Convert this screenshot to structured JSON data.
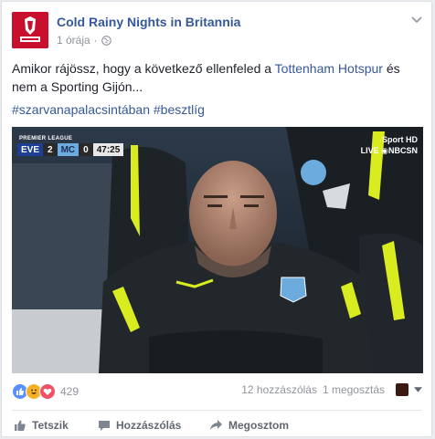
{
  "post": {
    "page_name": "Cold Rainy Nights in Britannia",
    "time": "1 órája",
    "meta_separator": "·",
    "text_part1": "Amikor rájössz, hogy a következő ellenfeled a ",
    "text_link": "Tottenham Hotspur",
    "text_part2": " és nem a Sporting Gijón...",
    "hashtag1": "#szarvanapalacsintában",
    "hashtag2": "#besztlíg"
  },
  "photo": {
    "league": "PREMIER LEAGUE",
    "home_team": "EVE",
    "home_score": "2",
    "away_team": "MC",
    "away_score": "0",
    "clock": "47:25",
    "broadcaster_line1": "Sport HD",
    "broadcaster_line2": "LIVE ◉NBCSN"
  },
  "stats": {
    "reaction_count": "429",
    "comments": "12 hozzászólás",
    "shares": "1 megosztás"
  },
  "actions": {
    "like": "Tetszik",
    "comment": "Hozzászólás",
    "share": "Megosztom"
  },
  "colors": {
    "link": "#365899",
    "page_avatar": "#c8102e",
    "like_blue": "#5890ff",
    "love_red": "#f25268",
    "haha_yellow": "#f7b125"
  },
  "icons": {
    "globe": "globe-icon",
    "chevron": "chevron-down-icon",
    "like": "thumbs-up-icon",
    "comment": "comment-icon",
    "share": "share-arrow-icon"
  }
}
